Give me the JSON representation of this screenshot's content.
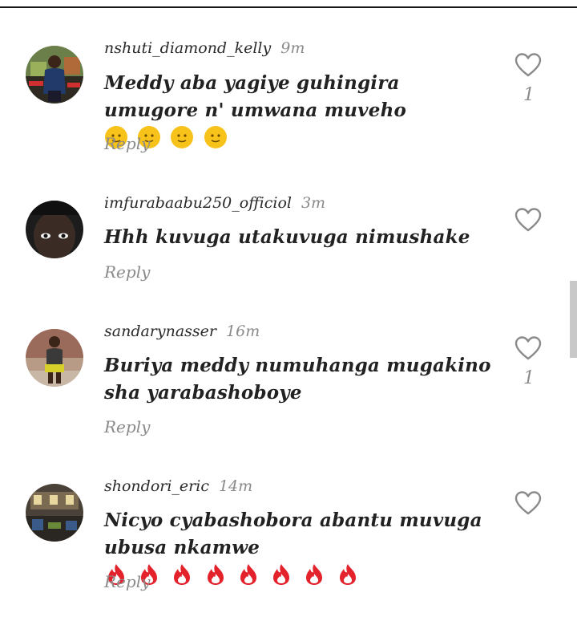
{
  "comments": [
    {
      "username": "nshuti_diamond_kelly",
      "time": "9m",
      "text": "Meddy aba yagiye guhingira umugore n' umwana muveho",
      "emoji_name": "moon-face-emoji",
      "emoji_count": 4,
      "likes": "1",
      "reply": "Reply",
      "avatar_color": "#2e4a2a"
    },
    {
      "username": "imfurabaabu250_officiol",
      "time": "3m",
      "text": "Hhh kuvuga utakuvuga nimushake",
      "likes": "",
      "reply": "Reply",
      "avatar_color": "#1c1c1c"
    },
    {
      "username": "sandarynasser",
      "time": "16m",
      "text": "Buriya meddy numuhanga mugakino sha yarabashoboye",
      "likes": "1",
      "reply": "Reply",
      "avatar_color": "#8a7a6a"
    },
    {
      "username": "shondori_eric",
      "time": "14m",
      "text": "Nicyo cyabashobora abantu muvuga ubusa nkamwe",
      "emoji_name": "fire-emoji",
      "emoji_count": 8,
      "likes": "",
      "reply": "Reply",
      "avatar_color": "#3a3a3a"
    }
  ],
  "colors": {
    "username": "#2a2a2a",
    "muted": "#8a8a8a",
    "emoji_yellow": "#f7c21a",
    "fire_red": "#e4222c"
  },
  "icons": {
    "like": "heart-outline-icon"
  }
}
